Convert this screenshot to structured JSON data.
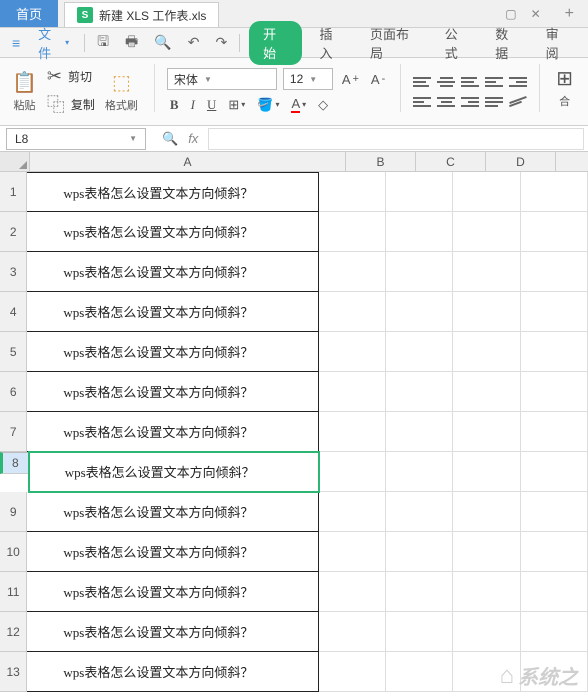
{
  "titlebar": {
    "home": "首页",
    "doc_name": "新建 XLS 工作表.xls"
  },
  "menubar": {
    "file": "文件",
    "start": "开始",
    "insert": "插入",
    "pagelayout": "页面布局",
    "formula": "公式",
    "data": "数据",
    "review": "审阅"
  },
  "ribbon": {
    "paste": "粘贴",
    "cut": "剪切",
    "copy": "复制",
    "formatpainter": "格式刷",
    "font_name": "宋体",
    "font_size": "12",
    "merge": "合"
  },
  "formula": {
    "cell_ref": "L8"
  },
  "columns": [
    "A",
    "B",
    "C",
    "D"
  ],
  "cell_text": "wps表格怎么设置文本方向倾斜？",
  "row_count": 13,
  "selected_row": 8,
  "watermark": "系统之"
}
